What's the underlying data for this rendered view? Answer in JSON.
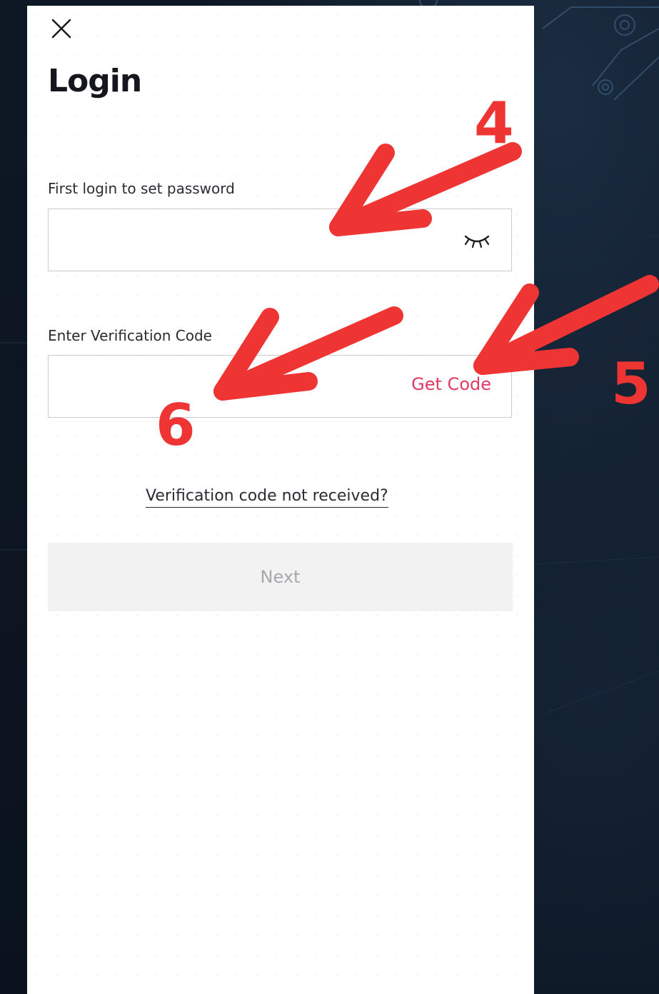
{
  "dialog": {
    "title": "Login"
  },
  "password_section": {
    "label": "First login to set password",
    "value": "",
    "visibility_icon": "eye-closed-icon"
  },
  "verification_section": {
    "label": "Enter Verification Code",
    "value": "",
    "get_code_label": "Get Code"
  },
  "links": {
    "not_received": "Verification code not received?"
  },
  "actions": {
    "next_label": "Next"
  },
  "annotations": {
    "step_4": "4",
    "step_5": "5",
    "step_6": "6"
  },
  "colors": {
    "accent": "#e03a63",
    "annotation": "#ef3434",
    "disabled_button_bg": "#f2f2f3",
    "disabled_button_text": "#a7a8ad",
    "background": "#0c1520"
  }
}
